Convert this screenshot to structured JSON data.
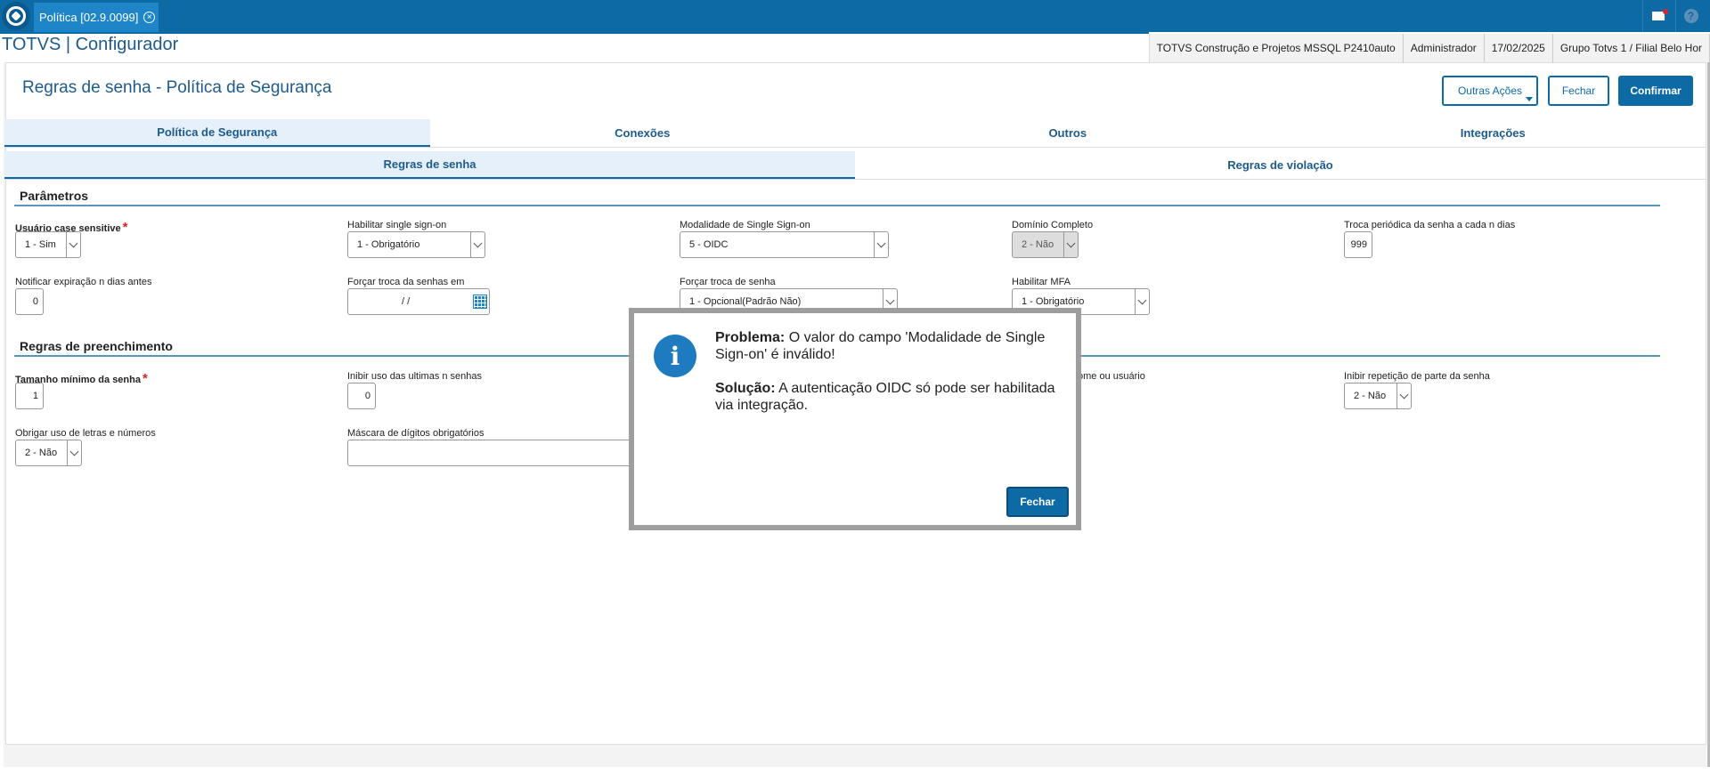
{
  "topbar": {
    "tab_label": "Política [02.9.0099]",
    "tab_close": "×",
    "help_glyph": "?"
  },
  "header": {
    "app_title": "TOTVS | Configurador",
    "info": [
      "TOTVS Construção e Projetos MSSQL P2410auto",
      "Administrador",
      "17/02/2025",
      "Grupo Totvs 1 / Filial Belo Hor"
    ]
  },
  "page": {
    "title": "Regras de senha - Política de Segurança",
    "buttons": {
      "more_actions": "Outras Ações",
      "close": "Fechar",
      "confirm": "Confirmar"
    }
  },
  "tabs_main": [
    "Política de Segurança",
    "Conexões",
    "Outros",
    "Integrações"
  ],
  "tabs_sub": [
    "Regras de senha",
    "Regras de violação"
  ],
  "sections": {
    "params": "Parâmetros",
    "fill": "Regras de preenchimento"
  },
  "fields": {
    "case_sensitive": {
      "label": "Usuário case sensitive",
      "value": "1 - Sim"
    },
    "sso_enable": {
      "label": "Habilitar single sign-on",
      "value": "1 - Obrigatório"
    },
    "sso_mode": {
      "label": "Modalidade de Single Sign-on",
      "value": "5 - OIDC"
    },
    "full_domain": {
      "label": "Domínio Completo",
      "value": "2 - Não"
    },
    "periodic_change": {
      "label": "Troca periódica da senha a cada n dias",
      "value": "999"
    },
    "notify_expire": {
      "label": "Notificar expiração n dias antes",
      "value": "0"
    },
    "force_change_date": {
      "label": "Forçar troca da senhas em",
      "value": "/ /"
    },
    "force_change": {
      "label": "Forçar troca de senha",
      "value": "1 - Opcional(Padrão Não)"
    },
    "mfa": {
      "label": "Habilitar MFA",
      "value": "1 - Obrigatório"
    },
    "min_size": {
      "label": "Tamanho mínimo da senha",
      "value": "1"
    },
    "inhibit_last": {
      "label": "Inibir uso das ultimas n senhas",
      "value": "0"
    },
    "name_user": {
      "label": "ome ou usuário"
    },
    "inhibit_repeat": {
      "label": "Inibir repetição de parte da senha",
      "value": "2 - Não"
    },
    "letters_numbers": {
      "label": "Obrigar uso de letras e números",
      "value": "2 - Não"
    },
    "digit_mask": {
      "label": "Máscara de dígitos obrigatórios",
      "value": ""
    }
  },
  "required_mark": "*",
  "modal": {
    "icon": "i",
    "problem_label": "Problema:",
    "problem_text": " O valor do campo 'Modalidade de Single Sign-on' é inválido!",
    "solution_label": "Solução:",
    "solution_text": " A autenticação OIDC só pode ser habilitada via integração.",
    "button": "Fechar"
  }
}
